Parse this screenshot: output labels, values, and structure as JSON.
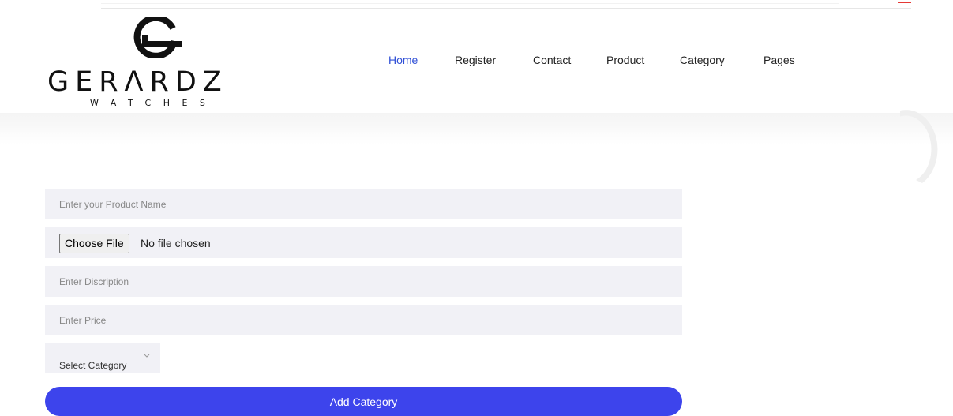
{
  "brand": {
    "name": "GERΛRDZ",
    "tagline": "WATCHES",
    "monogram": "G-monogram-logo"
  },
  "nav": {
    "items": [
      {
        "label": "Home",
        "active": true
      },
      {
        "label": "Register",
        "active": false
      },
      {
        "label": "Contact",
        "active": false
      },
      {
        "label": "Product",
        "active": false
      },
      {
        "label": "Category",
        "active": false
      },
      {
        "label": "Pages",
        "active": false
      }
    ]
  },
  "form": {
    "product_name_placeholder": "Enter your Product Name",
    "file_button_label": "Choose File",
    "file_status": "No file chosen",
    "description_placeholder": "Enter Discription",
    "price_placeholder": "Enter Price",
    "category_select": "Select Category",
    "submit_label": "Add Category"
  },
  "colors": {
    "accent": "#3d44ec",
    "nav_active": "#2f4fd6",
    "field_bg": "#f1f1f6"
  }
}
